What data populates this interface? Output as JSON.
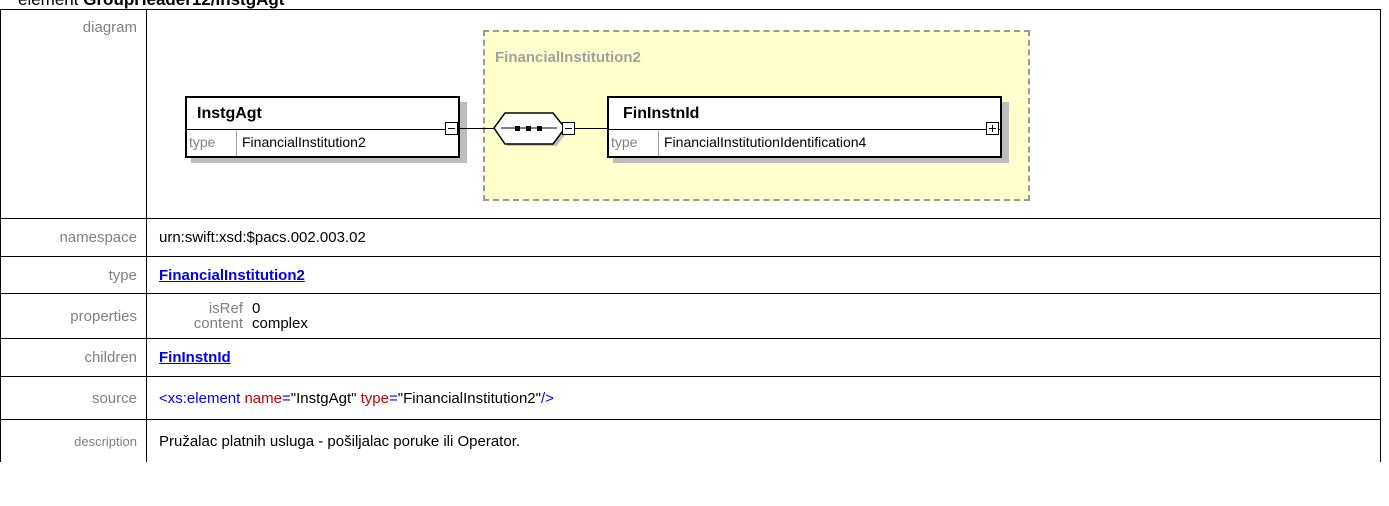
{
  "header": {
    "prefix": "element",
    "name": "GroupHeader12/InstgAgt"
  },
  "rows": {
    "diagram_label": "diagram",
    "namespace_label": "namespace",
    "namespace_value": "urn:swift:xsd:$pacs.002.003.02",
    "type_label": "type",
    "type_value": "FinancialInstitution2",
    "properties_label": "properties",
    "properties": [
      {
        "key": "isRef",
        "value": "0"
      },
      {
        "key": "content",
        "value": "complex"
      }
    ],
    "children_label": "children",
    "children_value": "FinInstnId",
    "source_label": "source",
    "source": {
      "open": "<xs:element",
      "attr1": "name",
      "eq1": "=",
      "val1": "\"InstgAgt\"",
      "attr2": "type",
      "eq2": "=",
      "val2": "\"FinancialInstitution2\"",
      "close": "/>"
    },
    "description_label": "description",
    "description_value": "Pružalac platnih usluga - pošiljalac poruke ili Operator."
  },
  "diagram": {
    "group_title": "FinancialInstitution2",
    "element1": {
      "name": "InstgAgt",
      "type_label": "type",
      "type_value": "FinancialInstitution2"
    },
    "element2": {
      "name": "FinInstnId",
      "type_label": "type",
      "type_value": "FinancialInstitutionIdentification4"
    }
  }
}
